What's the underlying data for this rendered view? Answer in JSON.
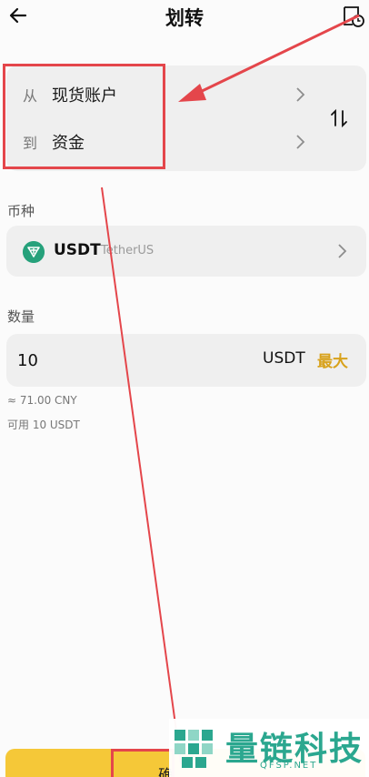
{
  "header": {
    "title": "划转",
    "back_icon": "arrow-left-icon",
    "history_icon": "transfer-history-icon"
  },
  "transfer": {
    "from_prefix": "从",
    "from_account": "现货账户",
    "to_prefix": "到",
    "to_account": "资金",
    "swap_icon": "swap-vertical-icon"
  },
  "coin": {
    "label": "币种",
    "symbol": "USDT",
    "name": "TetherUS",
    "icon": "tether-icon"
  },
  "amount": {
    "label": "数量",
    "value": "10",
    "unit": "USDT",
    "max_label": "最大",
    "approx": "≈ 71.00 CNY",
    "available": "可用 10 USDT"
  },
  "confirm": {
    "label": "确"
  },
  "watermark": {
    "text": "量链科技",
    "url": "QFSP.NET"
  },
  "colors": {
    "accent": "#f5c838",
    "max_text": "#d8a21c",
    "annotation": "#e4464b",
    "tether": "#26a17b",
    "watermark": "#2ba78f"
  }
}
